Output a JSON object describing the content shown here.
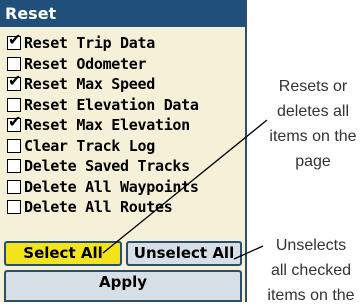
{
  "window": {
    "title": "Reset"
  },
  "options": [
    {
      "label": "Reset Trip Data",
      "checked": true
    },
    {
      "label": "Reset Odometer",
      "checked": false
    },
    {
      "label": "Reset Max Speed",
      "checked": true
    },
    {
      "label": "Reset Elevation Data",
      "checked": false
    },
    {
      "label": "Reset Max Elevation",
      "checked": true
    },
    {
      "label": "Clear Track Log",
      "checked": false
    },
    {
      "label": "Delete Saved Tracks",
      "checked": false
    },
    {
      "label": "Delete All Waypoints",
      "checked": false
    },
    {
      "label": "Delete All Routes",
      "checked": false
    }
  ],
  "buttons": {
    "select_all": "Select All",
    "unselect_all": "Unselect All",
    "apply": "Apply"
  },
  "callouts": {
    "resets": [
      "Resets or",
      "deletes all",
      "items on the",
      "page"
    ],
    "unselects": [
      "Unselects",
      "all checked",
      "items on the"
    ]
  },
  "icons": {
    "check": "checkmark-icon"
  },
  "colors": {
    "title_bar": "#1f4f7a",
    "panel": "#f4f1d8",
    "highlight": "#f2e31c",
    "button": "#d6dee6"
  }
}
